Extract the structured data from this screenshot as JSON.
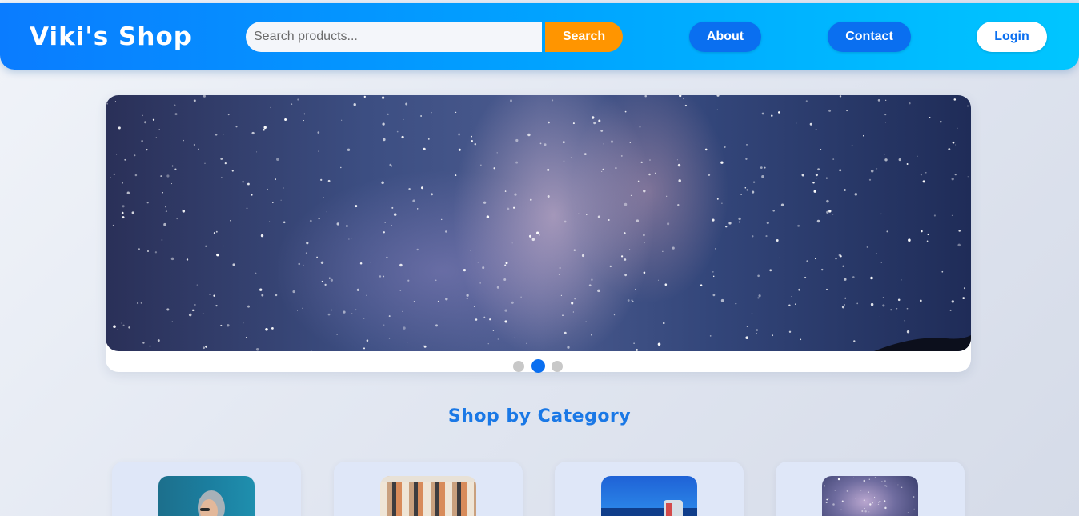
{
  "header": {
    "logo": "Viki's Shop",
    "search": {
      "placeholder": "Search products...",
      "value": "",
      "button_label": "Search"
    },
    "nav": {
      "about": "About",
      "contact": "Contact",
      "login": "Login"
    }
  },
  "carousel": {
    "slide_count": 3,
    "active_index": 1,
    "active_slide_subject": "starry night sky / milky way"
  },
  "categories": {
    "title": "Shop by Category",
    "items": [
      {
        "image": "person-in-hood-photo"
      },
      {
        "image": "clothes-rack-photo"
      },
      {
        "image": "beach-photo"
      },
      {
        "image": "night-sky-photo"
      }
    ]
  },
  "colors": {
    "header_gradient_start": "#0a7cff",
    "header_gradient_end": "#00c6ff",
    "search_button": "#ff9500",
    "nav_button": "#0a6ff0",
    "accent_text": "#1a78e6",
    "active_dot": "#0a6ff0",
    "inactive_dot": "#c8c8c8"
  }
}
